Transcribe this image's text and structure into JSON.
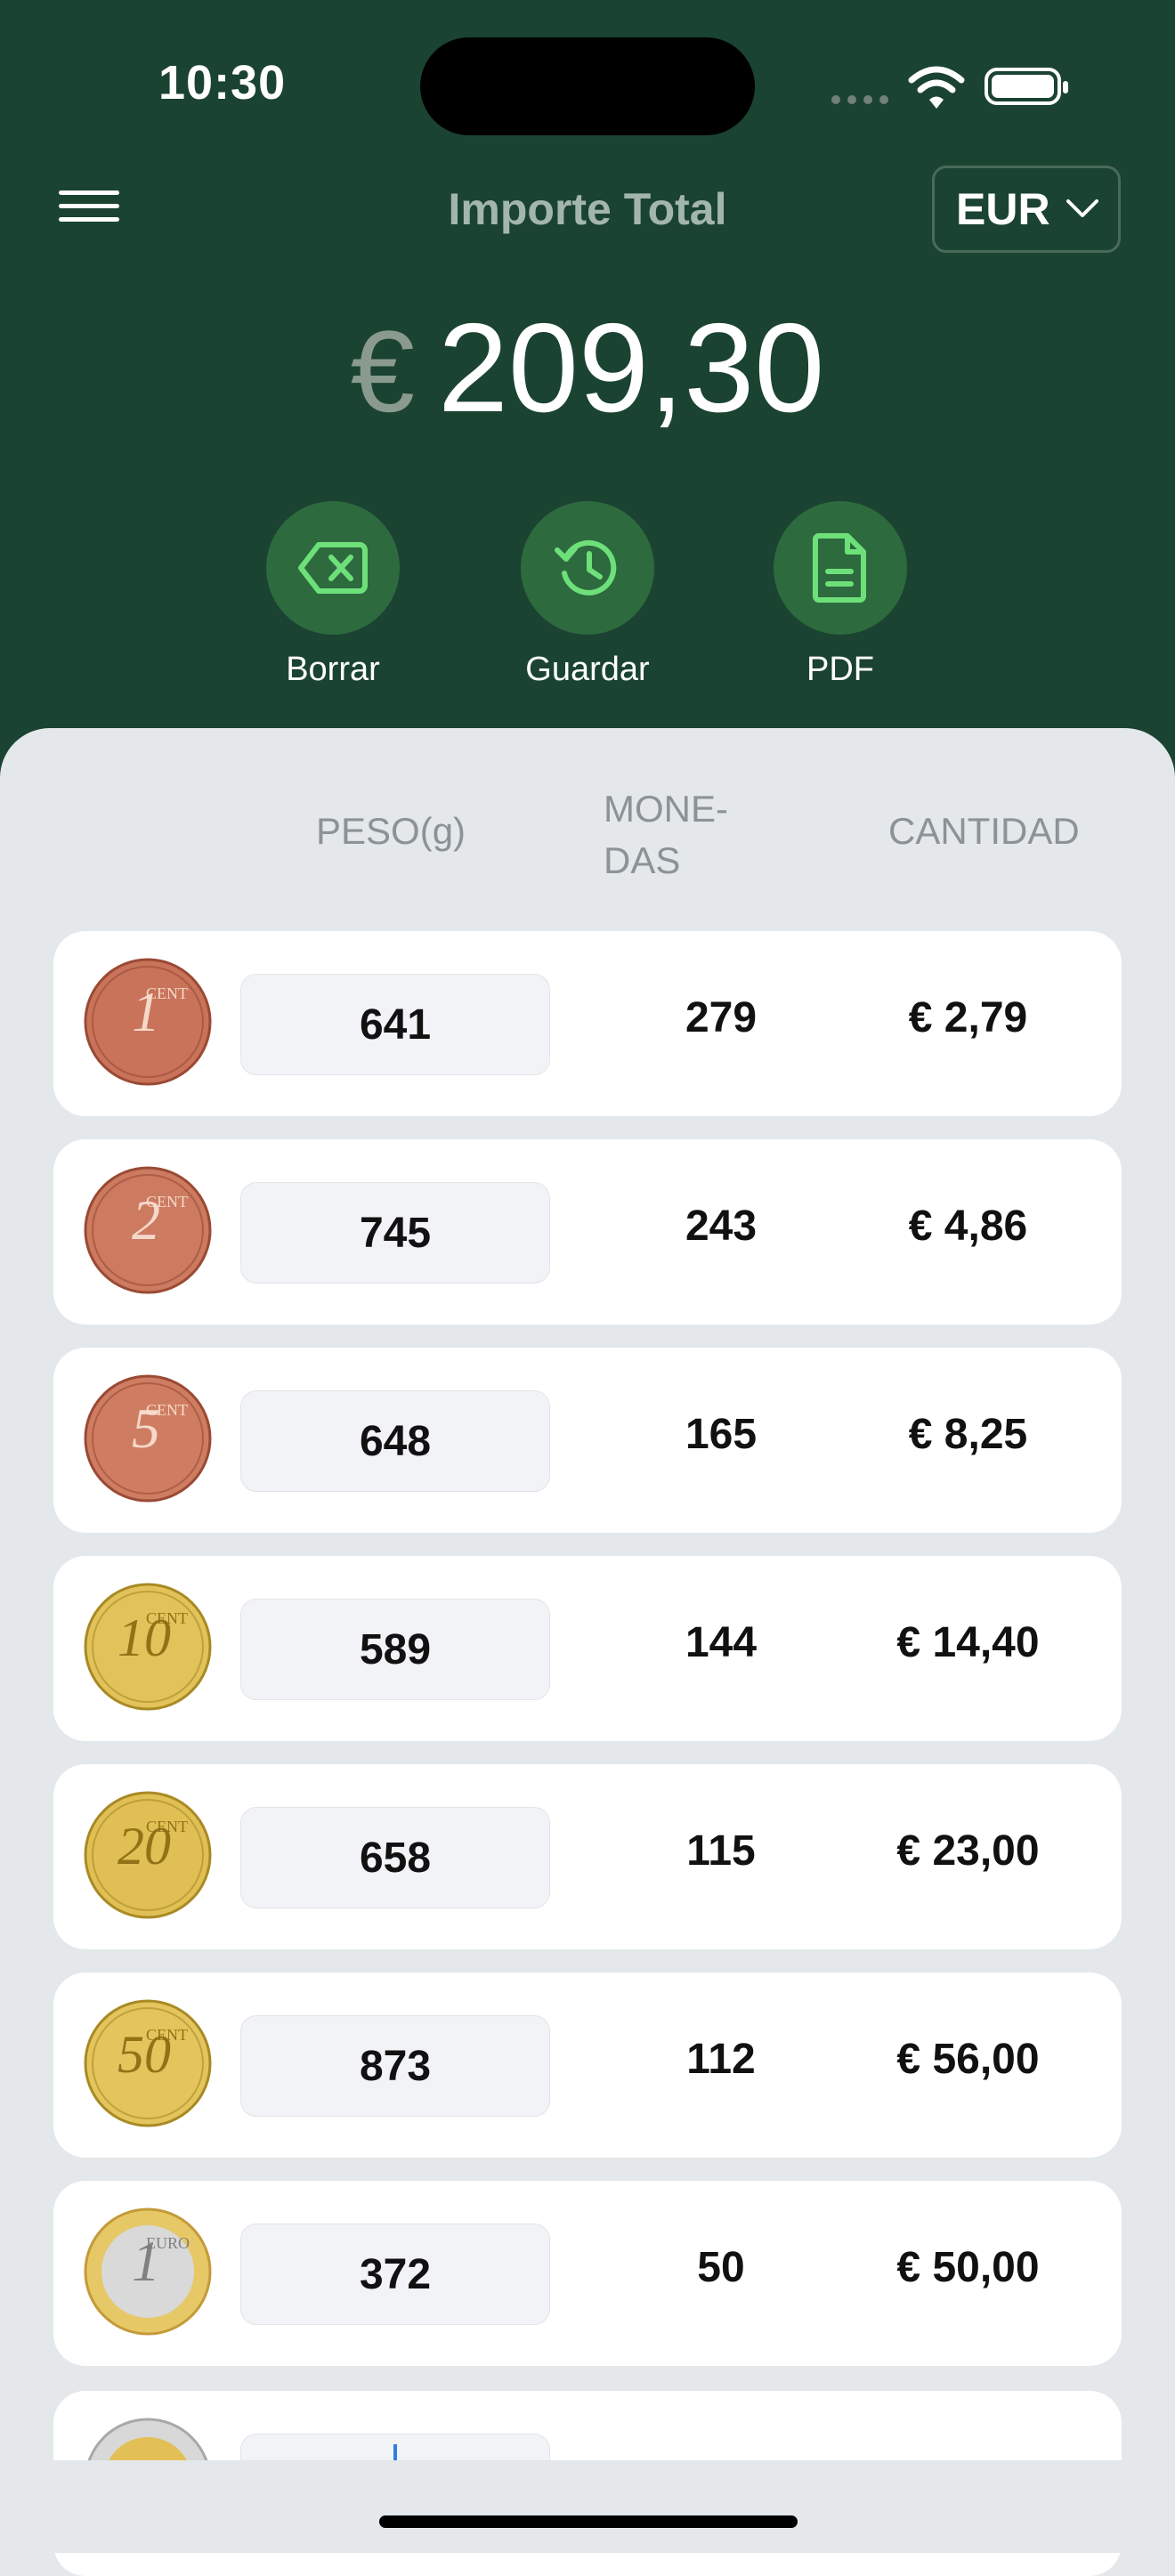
{
  "status_bar": {
    "time": "10:30"
  },
  "header": {
    "title": "Importe Total",
    "currency_selector": "EUR",
    "total_symbol": "€",
    "total_amount": "209,30"
  },
  "actions": [
    {
      "label": "Borrar",
      "icon": "backspace-icon"
    },
    {
      "label": "Guardar",
      "icon": "history-icon"
    },
    {
      "label": "PDF",
      "icon": "document-icon"
    }
  ],
  "columns": {
    "weight": "PESO(g)",
    "coins_line1": "MONE-",
    "coins_line2": "DAS",
    "amount": "CANTIDAD"
  },
  "rows": [
    {
      "coin": "1",
      "coin_unit": "CENT",
      "weight": "641",
      "count": "279",
      "amount": "€ 2,79"
    },
    {
      "coin": "2",
      "coin_unit": "CENT",
      "weight": "745",
      "count": "243",
      "amount": "€ 4,86"
    },
    {
      "coin": "5",
      "coin_unit": "CENT",
      "weight": "648",
      "count": "165",
      "amount": "€ 8,25"
    },
    {
      "coin": "10",
      "coin_unit": "CENT",
      "weight": "589",
      "count": "144",
      "amount": "€ 14,40"
    },
    {
      "coin": "20",
      "coin_unit": "CENT",
      "weight": "658",
      "count": "115",
      "amount": "€ 23,00"
    },
    {
      "coin": "50",
      "coin_unit": "CENT",
      "weight": "873",
      "count": "112",
      "amount": "€ 56,00"
    },
    {
      "coin": "1",
      "coin_unit": "EURO",
      "weight": "372",
      "count": "50",
      "amount": "€ 50,00"
    }
  ]
}
